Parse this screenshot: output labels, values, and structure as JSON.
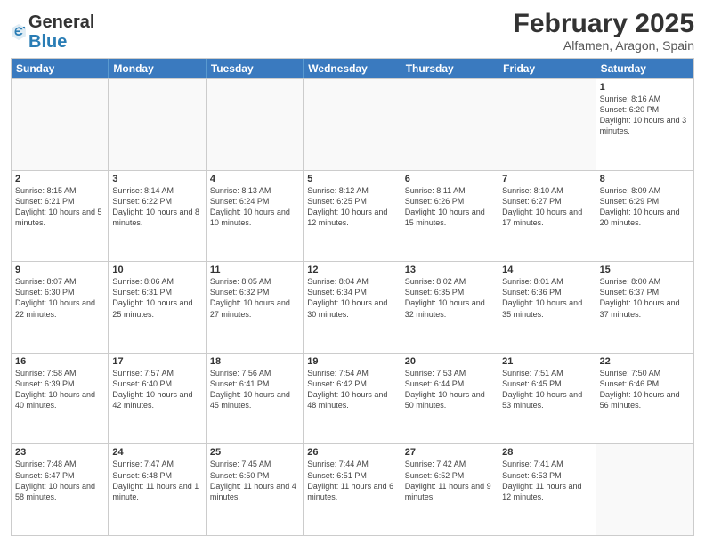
{
  "header": {
    "logo_general": "General",
    "logo_blue": "Blue",
    "month_title": "February 2025",
    "location": "Alfamen, Aragon, Spain"
  },
  "calendar": {
    "days_of_week": [
      "Sunday",
      "Monday",
      "Tuesday",
      "Wednesday",
      "Thursday",
      "Friday",
      "Saturday"
    ],
    "rows": [
      [
        {
          "day": "",
          "empty": true
        },
        {
          "day": "",
          "empty": true
        },
        {
          "day": "",
          "empty": true
        },
        {
          "day": "",
          "empty": true
        },
        {
          "day": "",
          "empty": true
        },
        {
          "day": "",
          "empty": true
        },
        {
          "day": "1",
          "sunrise": "8:16 AM",
          "sunset": "6:20 PM",
          "daylight": "10 hours and 3 minutes."
        }
      ],
      [
        {
          "day": "2",
          "sunrise": "8:15 AM",
          "sunset": "6:21 PM",
          "daylight": "10 hours and 5 minutes."
        },
        {
          "day": "3",
          "sunrise": "8:14 AM",
          "sunset": "6:22 PM",
          "daylight": "10 hours and 8 minutes."
        },
        {
          "day": "4",
          "sunrise": "8:13 AM",
          "sunset": "6:24 PM",
          "daylight": "10 hours and 10 minutes."
        },
        {
          "day": "5",
          "sunrise": "8:12 AM",
          "sunset": "6:25 PM",
          "daylight": "10 hours and 12 minutes."
        },
        {
          "day": "6",
          "sunrise": "8:11 AM",
          "sunset": "6:26 PM",
          "daylight": "10 hours and 15 minutes."
        },
        {
          "day": "7",
          "sunrise": "8:10 AM",
          "sunset": "6:27 PM",
          "daylight": "10 hours and 17 minutes."
        },
        {
          "day": "8",
          "sunrise": "8:09 AM",
          "sunset": "6:29 PM",
          "daylight": "10 hours and 20 minutes."
        }
      ],
      [
        {
          "day": "9",
          "sunrise": "8:07 AM",
          "sunset": "6:30 PM",
          "daylight": "10 hours and 22 minutes."
        },
        {
          "day": "10",
          "sunrise": "8:06 AM",
          "sunset": "6:31 PM",
          "daylight": "10 hours and 25 minutes."
        },
        {
          "day": "11",
          "sunrise": "8:05 AM",
          "sunset": "6:32 PM",
          "daylight": "10 hours and 27 minutes."
        },
        {
          "day": "12",
          "sunrise": "8:04 AM",
          "sunset": "6:34 PM",
          "daylight": "10 hours and 30 minutes."
        },
        {
          "day": "13",
          "sunrise": "8:02 AM",
          "sunset": "6:35 PM",
          "daylight": "10 hours and 32 minutes."
        },
        {
          "day": "14",
          "sunrise": "8:01 AM",
          "sunset": "6:36 PM",
          "daylight": "10 hours and 35 minutes."
        },
        {
          "day": "15",
          "sunrise": "8:00 AM",
          "sunset": "6:37 PM",
          "daylight": "10 hours and 37 minutes."
        }
      ],
      [
        {
          "day": "16",
          "sunrise": "7:58 AM",
          "sunset": "6:39 PM",
          "daylight": "10 hours and 40 minutes."
        },
        {
          "day": "17",
          "sunrise": "7:57 AM",
          "sunset": "6:40 PM",
          "daylight": "10 hours and 42 minutes."
        },
        {
          "day": "18",
          "sunrise": "7:56 AM",
          "sunset": "6:41 PM",
          "daylight": "10 hours and 45 minutes."
        },
        {
          "day": "19",
          "sunrise": "7:54 AM",
          "sunset": "6:42 PM",
          "daylight": "10 hours and 48 minutes."
        },
        {
          "day": "20",
          "sunrise": "7:53 AM",
          "sunset": "6:44 PM",
          "daylight": "10 hours and 50 minutes."
        },
        {
          "day": "21",
          "sunrise": "7:51 AM",
          "sunset": "6:45 PM",
          "daylight": "10 hours and 53 minutes."
        },
        {
          "day": "22",
          "sunrise": "7:50 AM",
          "sunset": "6:46 PM",
          "daylight": "10 hours and 56 minutes."
        }
      ],
      [
        {
          "day": "23",
          "sunrise": "7:48 AM",
          "sunset": "6:47 PM",
          "daylight": "10 hours and 58 minutes."
        },
        {
          "day": "24",
          "sunrise": "7:47 AM",
          "sunset": "6:48 PM",
          "daylight": "11 hours and 1 minute."
        },
        {
          "day": "25",
          "sunrise": "7:45 AM",
          "sunset": "6:50 PM",
          "daylight": "11 hours and 4 minutes."
        },
        {
          "day": "26",
          "sunrise": "7:44 AM",
          "sunset": "6:51 PM",
          "daylight": "11 hours and 6 minutes."
        },
        {
          "day": "27",
          "sunrise": "7:42 AM",
          "sunset": "6:52 PM",
          "daylight": "11 hours and 9 minutes."
        },
        {
          "day": "28",
          "sunrise": "7:41 AM",
          "sunset": "6:53 PM",
          "daylight": "11 hours and 12 minutes."
        },
        {
          "day": "",
          "empty": true
        }
      ]
    ]
  }
}
